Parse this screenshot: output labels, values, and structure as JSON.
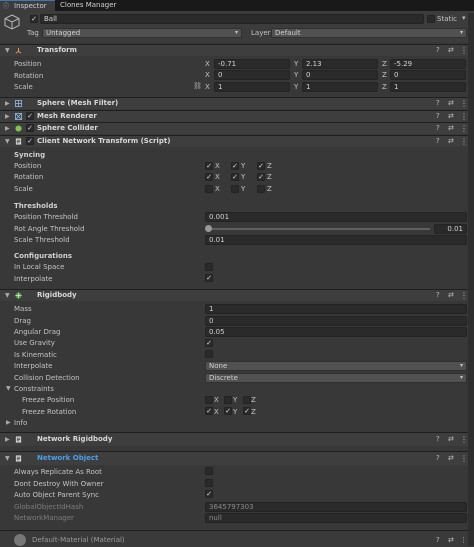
{
  "tabs": [
    {
      "label": "Inspector"
    },
    {
      "label": "Clones Manager"
    }
  ],
  "object": {
    "name": "Ball",
    "static_label": "Static",
    "tag_label": "Tag",
    "tag_value": "Untagged",
    "layer_label": "Layer",
    "layer_value": "Default"
  },
  "transform": {
    "title": "Transform",
    "position_label": "Position",
    "rotation_label": "Rotation",
    "scale_label": "Scale",
    "position": {
      "x": "-0.71",
      "y": "2.13",
      "z": "-5.29"
    },
    "rotation": {
      "x": "0",
      "y": "0",
      "z": "0"
    },
    "scale": {
      "x": "1",
      "y": "1",
      "z": "1"
    }
  },
  "axes": {
    "x": "X",
    "y": "Y",
    "z": "Z"
  },
  "components": {
    "mesh_filter": "Sphere (Mesh Filter)",
    "mesh_renderer": "Mesh Renderer",
    "sphere_collider": "Sphere Collider",
    "client_network_transform": "Client Network Transform (Script)",
    "rigidbody": "Rigidbody",
    "network_rigidbody": "Network Rigidbody",
    "network_object": "Network Object"
  },
  "cnt": {
    "syncing": "Syncing",
    "position": "Position",
    "rotation": "Rotation",
    "scale": "Scale",
    "thresholds": "Thresholds",
    "position_threshold_label": "Position Threshold",
    "position_threshold": "0.001",
    "rot_angle_threshold_label": "Rot Angle Threshold",
    "rot_angle_threshold": "0.01",
    "scale_threshold_label": "Scale Threshold",
    "scale_threshold": "0.01",
    "configurations": "Configurations",
    "in_local_space": "In Local Space",
    "interpolate": "Interpolate"
  },
  "rb": {
    "mass_label": "Mass",
    "mass": "1",
    "drag_label": "Drag",
    "drag": "0",
    "angular_drag_label": "Angular Drag",
    "angular_drag": "0.05",
    "use_gravity": "Use Gravity",
    "is_kinematic": "Is Kinematic",
    "interpolate_label": "Interpolate",
    "interpolate": "None",
    "collision_label": "Collision Detection",
    "collision": "Discrete",
    "constraints": "Constraints",
    "freeze_position": "Freeze Position",
    "freeze_rotation": "Freeze Rotation",
    "info": "Info"
  },
  "no": {
    "always_replicate": "Always Replicate As Root",
    "dont_destroy": "Dont Destroy With Owner",
    "auto_parent": "Auto Object Parent Sync",
    "global_hash_label": "GlobalObjectIdHash",
    "global_hash": "3645797303",
    "network_manager_label": "NetworkManager",
    "network_manager": "null"
  },
  "footer": {
    "material": "Default-Material (Material)"
  },
  "colors": {
    "accent": "#3a79bb",
    "link": "#4c9ee8",
    "bg": "#383838"
  }
}
